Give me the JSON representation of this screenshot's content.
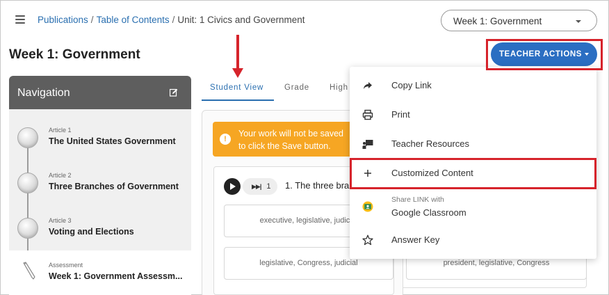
{
  "breadcrumb": {
    "link1": "Publications",
    "link2": "Table of Contents",
    "current": "Unit: 1 Civics and Government"
  },
  "week_select": {
    "value": "Week 1: Government"
  },
  "page_title": "Week 1: Government",
  "teacher_actions_label": "TEACHER ACTIONS",
  "navigation": {
    "title": "Navigation",
    "items": [
      {
        "type": "Article 1",
        "title": "The United States Government"
      },
      {
        "type": "Article 2",
        "title": "Three Branches of Government"
      },
      {
        "type": "Article 3",
        "title": "Voting and Elections"
      },
      {
        "type": "Assessment",
        "title": "Week 1: Government Assessm..."
      }
    ]
  },
  "tabs": [
    "Student View",
    "Grade",
    "High"
  ],
  "warning": {
    "line1": "Your work will not be saved",
    "line2": "to click the Save button."
  },
  "question": {
    "skip_count": "1",
    "text": "1.  The three bra"
  },
  "answers": [
    "executive, legislative, judicial",
    "legislative, Congress, judicial",
    "president, legislative, Congress"
  ],
  "menu": {
    "copy_link": "Copy Link",
    "print": "Print",
    "teacher_resources": "Teacher Resources",
    "customized_content": "Customized Content",
    "share_small": "Share LINK with",
    "google_classroom": "Google Classroom",
    "answer_key": "Answer Key"
  },
  "colors": {
    "accent_blue": "#2b6ec2",
    "link_blue": "#2a6fb0",
    "warning_orange": "#f6a623",
    "highlight_red": "#d6232b",
    "nav_header": "#5e5e5e"
  },
  "icons": {
    "menu": "hamburger-icon",
    "edit": "edit-icon",
    "copy_link": "share-arrow-icon",
    "print": "printer-icon",
    "teacher_resources": "presentation-icon",
    "customized_content": "plus-icon",
    "google_classroom": "google-classroom-icon",
    "answer_key": "star-icon"
  }
}
